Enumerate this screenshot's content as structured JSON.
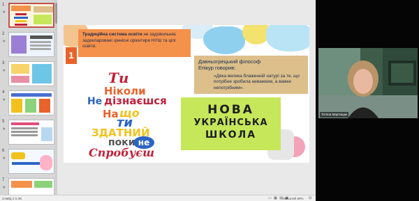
{
  "thumbnails": [
    {
      "number": "1",
      "star": "★",
      "selected": true
    },
    {
      "number": "2",
      "star": "★",
      "selected": false
    },
    {
      "number": "3",
      "star": "★",
      "selected": false
    },
    {
      "number": "4",
      "star": "★",
      "selected": false
    },
    {
      "number": "5",
      "star": "★",
      "selected": false
    },
    {
      "number": "6",
      "star": "★",
      "selected": false
    },
    {
      "number": "7",
      "star": "★",
      "selected": false
    }
  ],
  "slide": {
    "number_badge": "1",
    "box1_bold": "Традиційна система освіти",
    "box1_rest": " не задовольняє задекларовані ціннісні орієнтири НУШ та цілі освіти.",
    "quote_head_1": "Давньогрецький філософ",
    "quote_head_2": "Епікур говорив:",
    "quote_text": "«Дяка велика блаженній натурі за те, що потрібне зробила неважким, а важке непотрібним».",
    "nus_line1": "НОВА",
    "nus_line2": "УКРАЇНСЬКА",
    "nus_line3": "ШКОЛА",
    "phrase": {
      "w1": "Ти",
      "w2": "Ніколи",
      "w3": "Не",
      "w4": "дізнаєшся",
      "w5": "На",
      "w6": "що",
      "w7": "ти",
      "w8": "ЗДАТНИЙ",
      "w9": "поки",
      "w10": "не",
      "w11": "Спробуєш"
    }
  },
  "statusbar": {
    "slide_count": "Слайд 1 із 36",
    "zoom": "Масштаб 60%",
    "view_icons": "▭ ▦ ▤ ▣"
  },
  "video": {
    "participant_name": "Тетяна Мартищак"
  },
  "colors": {
    "orange": "#f4914b",
    "accent_orange": "#e8632b",
    "tan": "#dcbf8a",
    "lime": "#c6e75a",
    "red_word": "#c0203a",
    "blue_word": "#2c64c4",
    "yellow_word": "#f2c21c"
  }
}
